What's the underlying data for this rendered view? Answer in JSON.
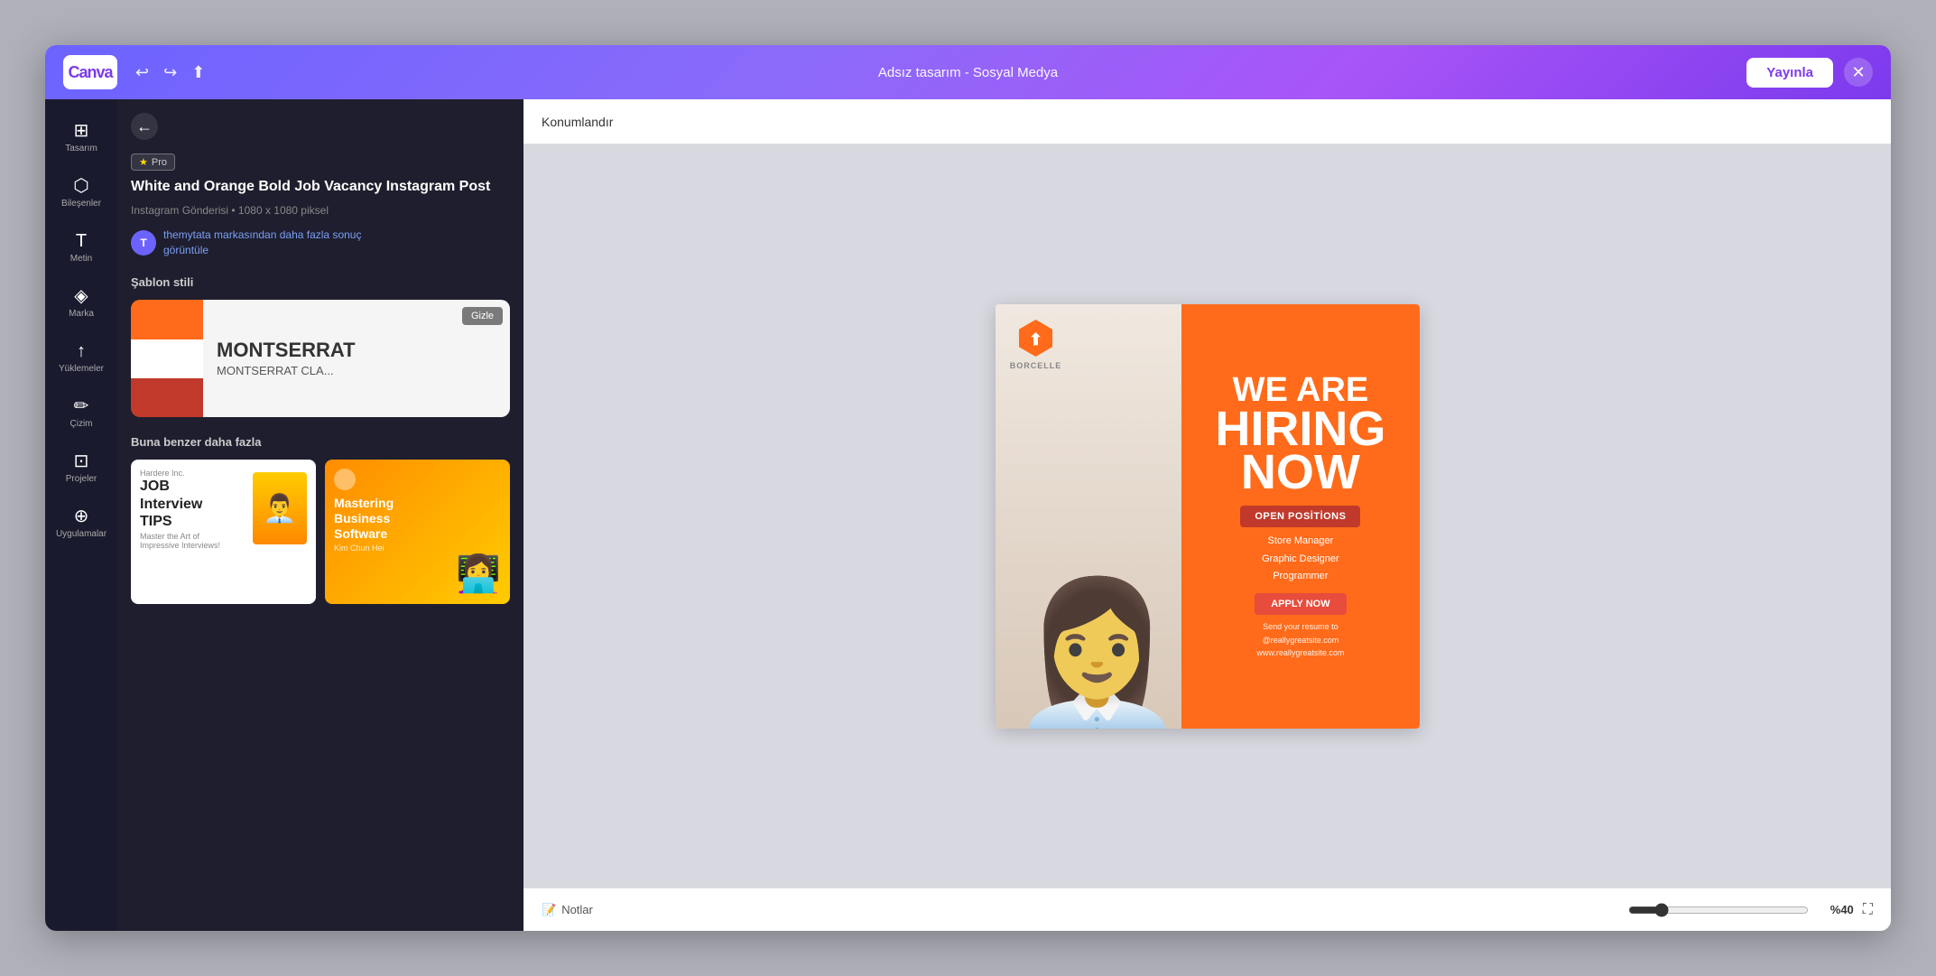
{
  "topbar": {
    "logo": "Canva",
    "title": "Adsız tasarım - Sosyal Medya",
    "publish_label": "Yayınla",
    "undo_icon": "undo",
    "redo_icon": "redo",
    "share_icon": "share"
  },
  "sidebar": {
    "items": [
      {
        "id": "tasarim",
        "label": "Tasarım",
        "icon": "⊞"
      },
      {
        "id": "bilesen",
        "label": "Bileşenler",
        "icon": "⬡"
      },
      {
        "id": "metin",
        "label": "Metin",
        "icon": "T"
      },
      {
        "id": "marka",
        "label": "Marka",
        "icon": "◈"
      },
      {
        "id": "yuklemeler",
        "label": "Yüklemeler",
        "icon": "↑"
      },
      {
        "id": "cizim",
        "label": "Çizim",
        "icon": "✏"
      },
      {
        "id": "projeler",
        "label": "Projeler",
        "icon": "⊡"
      },
      {
        "id": "uygulamalar",
        "label": "Uygulamalar",
        "icon": "⊕"
      }
    ]
  },
  "left_panel": {
    "pro_label": "Pro",
    "template_title": "White and Orange Bold Job Vacancy Instagram Post",
    "template_meta": "Instagram Gönderisi • 1080 x 1080 piksel",
    "author_initial": "T",
    "author_text": "themytata markasından daha fazla sonuç",
    "author_link": "görüntüle",
    "style_section": "Şablon stili",
    "style_font_large": "MONTSERRAT",
    "style_font_small": "MONTSERRAT CLA...",
    "hide_label": "Gizle",
    "similar_section": "Buna benzer daha fazla",
    "similar_items": [
      {
        "id": "job-tips",
        "title": "JOB Interview TIPS",
        "subtitle": "Master the Art of Impressive Interviews!"
      },
      {
        "id": "business-software",
        "title": "Mastering Business Software",
        "subtitle": "Kim Chun Hei"
      }
    ]
  },
  "konumlandir_bar": {
    "label": "Konumlandır"
  },
  "design_card": {
    "logo_company": "BORCELLE",
    "headline1": "WE ARE",
    "headline2": "HIRING",
    "headline3": "NOW",
    "open_positions_label": "OPEN POSİTİONS",
    "position1": "Store Manager",
    "position2": "Graphic Designer",
    "position3": "Programmer",
    "apply_label": "APPLY NOW",
    "contact1": "Send your resume to",
    "contact2": "@reallygreatsite.com",
    "contact3": "www.reallygreatsite.com"
  },
  "bottom_bar": {
    "notes_label": "Notlar",
    "zoom_percent": "%40"
  },
  "colors": {
    "orange": "#ff6b1a",
    "dark_red": "#c0392b",
    "purple": "#7c3aed",
    "dark_bg": "#1e1e2e"
  }
}
